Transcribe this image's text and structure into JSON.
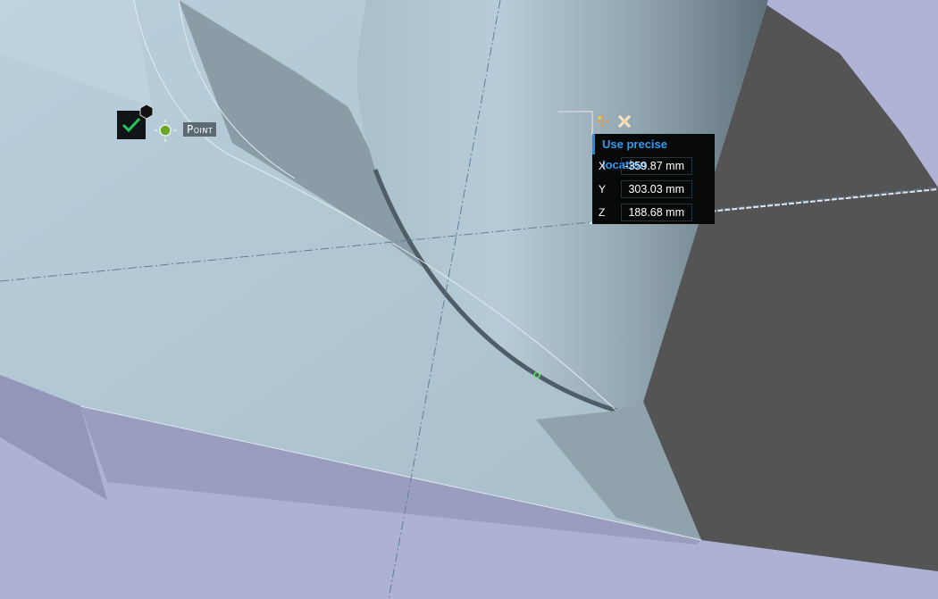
{
  "snap_marker": {
    "label": "Point",
    "confirm_icon": "check-icon",
    "accent": "#22c55e"
  },
  "precise_location": {
    "title": "Use precise location",
    "fields": [
      {
        "axis": "X",
        "value": "-359.87 mm"
      },
      {
        "axis": "Y",
        "value": "303.03 mm"
      },
      {
        "axis": "Z",
        "value": "188.68 mm"
      }
    ],
    "accent": "#2f9bf0"
  },
  "toolbar": {
    "icons": [
      "move-handle-icon",
      "close-icon"
    ]
  }
}
